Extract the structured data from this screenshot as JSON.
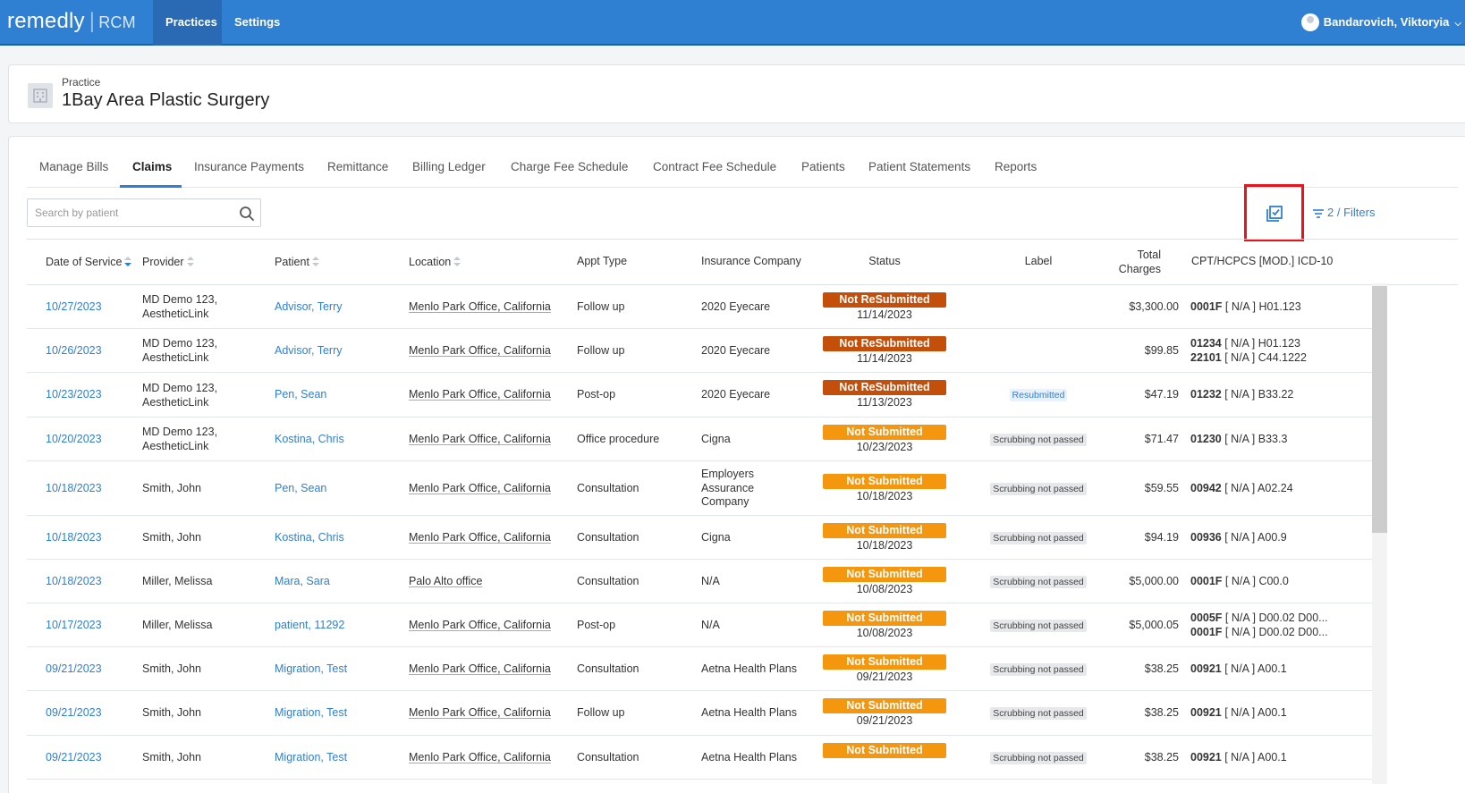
{
  "app": {
    "brand": "remedly",
    "product": "RCM"
  },
  "topnav": {
    "tabs": [
      "Practices",
      "Settings"
    ],
    "user": "Bandarovich, Viktoryia"
  },
  "practice": {
    "label": "Practice",
    "name": "1Bay Area Plastic Surgery"
  },
  "tabs": [
    "Manage Bills",
    "Claims",
    "Insurance Payments",
    "Remittance",
    "Billing Ledger",
    "Charge Fee Schedule",
    "Contract Fee Schedule",
    "Patients",
    "Patient Statements",
    "Reports"
  ],
  "active_tab": "Claims",
  "search": {
    "placeholder": "Search by patient"
  },
  "filters": {
    "label": "2 / Filters"
  },
  "columns": {
    "date": "Date of Service",
    "provider": "Provider",
    "patient": "Patient",
    "location": "Location",
    "appt": "Appt Type",
    "insurance": "Insurance Company",
    "status": "Status",
    "label": "Label",
    "charges_1": "Total",
    "charges_2": "Charges",
    "cpt": "CPT/HCPCS [MOD.] ICD-10"
  },
  "rows": [
    {
      "date": "10/27/2023",
      "provider": [
        "MD Demo 123,",
        "AestheticLink"
      ],
      "patient": "Advisor, Terry",
      "location": "Menlo Park Office, California",
      "appt": "Follow up",
      "insurance": [
        "2020 Eyecare"
      ],
      "status": "Not ReSubmitted",
      "status_date": "11/14/2023",
      "label": "",
      "charges": "$3,300.00",
      "cpt": [
        {
          "code": "0001F",
          "rest": " [ N/A ] H01.123"
        }
      ]
    },
    {
      "date": "10/26/2023",
      "provider": [
        "MD Demo 123,",
        "AestheticLink"
      ],
      "patient": "Advisor, Terry",
      "location": "Menlo Park Office, California",
      "appt": "Follow up",
      "insurance": [
        "2020 Eyecare"
      ],
      "status": "Not ReSubmitted",
      "status_date": "11/14/2023",
      "label": "",
      "charges": "$99.85",
      "cpt": [
        {
          "code": "01234",
          "rest": " [ N/A ] H01.123"
        },
        {
          "code": "22101",
          "rest": " [ N/A ] C44.1222"
        }
      ]
    },
    {
      "date": "10/23/2023",
      "provider": [
        "MD Demo 123,",
        "AestheticLink"
      ],
      "patient": "Pen, Sean",
      "location": "Menlo Park Office, California",
      "appt": "Post-op",
      "insurance": [
        "2020 Eyecare"
      ],
      "status": "Not ReSubmitted",
      "status_date": "11/13/2023",
      "label": "Resubmitted",
      "charges": "$47.19",
      "cpt": [
        {
          "code": "01232",
          "rest": " [ N/A ] B33.22"
        }
      ]
    },
    {
      "date": "10/20/2023",
      "provider": [
        "MD Demo 123,",
        "AestheticLink"
      ],
      "patient": "Kostina, Chris",
      "location": "Menlo Park Office, California",
      "appt": "Office procedure",
      "insurance": [
        "Cigna"
      ],
      "status": "Not Submitted",
      "status_date": "10/23/2023",
      "label": "Scrubbing not passed",
      "charges": "$71.47",
      "cpt": [
        {
          "code": "01230",
          "rest": " [ N/A ] B33.3"
        }
      ]
    },
    {
      "date": "10/18/2023",
      "provider": [
        "Smith, John"
      ],
      "patient": "Pen, Sean",
      "location": "Menlo Park Office, California",
      "appt": "Consultation",
      "insurance": [
        "Employers",
        "Assurance",
        "Company"
      ],
      "status": "Not Submitted",
      "status_date": "10/18/2023",
      "label": "Scrubbing not passed",
      "charges": "$59.55",
      "cpt": [
        {
          "code": "00942",
          "rest": " [ N/A ] A02.24"
        }
      ]
    },
    {
      "date": "10/18/2023",
      "provider": [
        "Smith, John"
      ],
      "patient": "Kostina, Chris",
      "location": "Menlo Park Office, California",
      "appt": "Consultation",
      "insurance": [
        "Cigna"
      ],
      "status": "Not Submitted",
      "status_date": "10/18/2023",
      "label": "Scrubbing not passed",
      "charges": "$94.19",
      "cpt": [
        {
          "code": "00936",
          "rest": " [ N/A ] A00.9"
        }
      ]
    },
    {
      "date": "10/18/2023",
      "provider": [
        "Miller, Melissa"
      ],
      "patient": "Mara, Sara",
      "location": "Palo Alto office",
      "appt": "Consultation",
      "insurance": [
        "N/A"
      ],
      "status": "Not Submitted",
      "status_date": "10/08/2023",
      "label": "Scrubbing not passed",
      "charges": "$5,000.00",
      "cpt": [
        {
          "code": "0001F",
          "rest": " [ N/A ] C00.0"
        }
      ]
    },
    {
      "date": "10/17/2023",
      "provider": [
        "Miller, Melissa"
      ],
      "patient": "patient, 11292",
      "location": "Menlo Park Office, California",
      "appt": "Post-op",
      "insurance": [
        "N/A"
      ],
      "status": "Not Submitted",
      "status_date": "10/08/2023",
      "label": "Scrubbing not passed",
      "charges": "$5,000.05",
      "cpt": [
        {
          "code": "0005F",
          "rest": " [ N/A ] D00.02 D00..."
        },
        {
          "code": "0001F",
          "rest": " [ N/A ] D00.02 D00..."
        }
      ]
    },
    {
      "date": "09/21/2023",
      "provider": [
        "Smith, John"
      ],
      "patient": "Migration, Test",
      "location": "Menlo Park Office, California",
      "appt": "Consultation",
      "insurance": [
        "Aetna Health Plans"
      ],
      "status": "Not Submitted",
      "status_date": "09/21/2023",
      "label": "Scrubbing not passed",
      "charges": "$38.25",
      "cpt": [
        {
          "code": "00921",
          "rest": " [ N/A ] A00.1"
        }
      ]
    },
    {
      "date": "09/21/2023",
      "provider": [
        "Smith, John"
      ],
      "patient": "Migration, Test",
      "location": "Menlo Park Office, California",
      "appt": "Follow up",
      "insurance": [
        "Aetna Health Plans"
      ],
      "status": "Not Submitted",
      "status_date": "09/21/2023",
      "label": "Scrubbing not passed",
      "charges": "$38.25",
      "cpt": [
        {
          "code": "00921",
          "rest": " [ N/A ] A00.1"
        }
      ]
    },
    {
      "date": "09/21/2023",
      "provider": [
        "Smith, John"
      ],
      "patient": "Migration, Test",
      "location": "Menlo Park Office, California",
      "appt": "Consultation",
      "insurance": [
        "Aetna Health Plans"
      ],
      "status": "Not Submitted",
      "status_date": "",
      "label": "Scrubbing not passed",
      "charges": "$38.25",
      "cpt": [
        {
          "code": "00921",
          "rest": " [ N/A ] A00.1"
        }
      ]
    }
  ],
  "colors": {
    "topbar": "#2f7fd3",
    "accent": "#2f7fd3",
    "not_resubmitted": "#c44f0a",
    "not_submitted": "#f5960f",
    "highlight_box": "#e8141b"
  }
}
